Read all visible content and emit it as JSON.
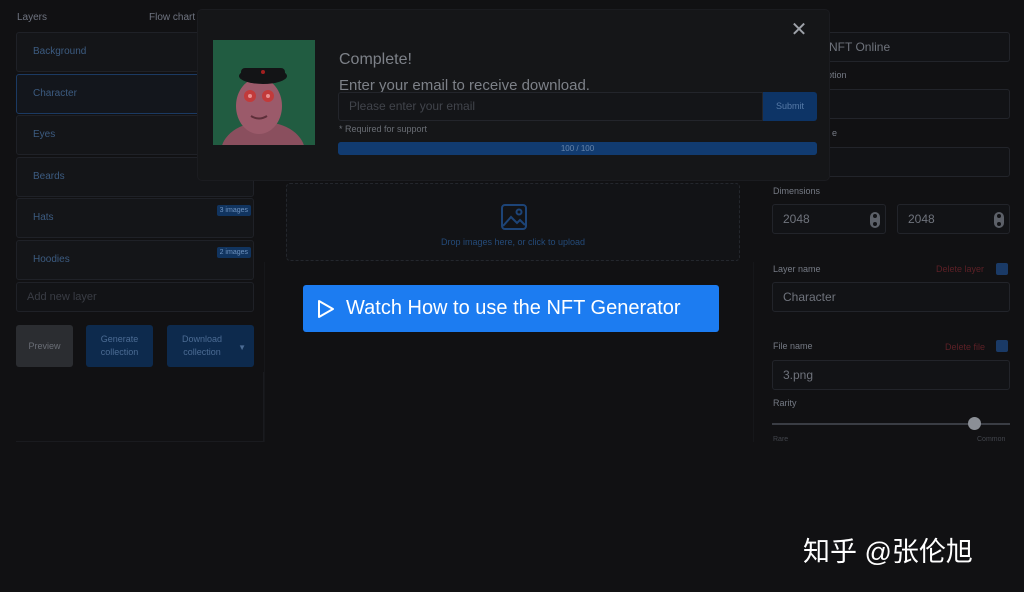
{
  "left": {
    "heading_layers": "Layers",
    "heading_flow": "Flow chart",
    "layers": [
      {
        "label": "Background",
        "badge": ""
      },
      {
        "label": "Character",
        "badge": ""
      },
      {
        "label": "Eyes",
        "badge": ""
      },
      {
        "label": "Beards",
        "badge": ""
      },
      {
        "label": "Hats",
        "badge": "3 images"
      },
      {
        "label": "Hoodies",
        "badge": "2 images"
      }
    ],
    "add_layer_placeholder": "Add new layer",
    "preview_label": "Preview",
    "generate_label": "Generate collection",
    "download_label": "Download collection"
  },
  "center": {
    "drop_text": "Drop images here, or click to upload"
  },
  "right": {
    "title_label_partial": "e",
    "title_value_partial": "e NFT Online",
    "description_label_partial": "ription",
    "size_label_partial": "e",
    "dimensions_label": "Dimensions",
    "width_value": "2048",
    "height_value": "2048",
    "layer_name_label": "Layer name",
    "delete_layer": "Delete layer",
    "layer_name_value": "Character",
    "file_name_label": "File name",
    "delete_file": "Delete file",
    "file_name_value": "3.png",
    "rarity_label": "Rarity",
    "rarity_min": "Rare",
    "rarity_max": "Common",
    "rarity_value": 0.85
  },
  "modal": {
    "title": "Complete!",
    "subtitle": "Enter your email to receive download.",
    "email_placeholder": "Please enter your email",
    "submit_label": "Submit",
    "required_note": "* Required for support",
    "progress_text": "100 / 100",
    "progress_fraction": 1.0,
    "close_glyph": "✕"
  },
  "watch_button": {
    "label": "Watch How to use the NFT Generator"
  },
  "watermark": {
    "text": "知乎 @张伦旭"
  },
  "colors": {
    "accent": "#1c7cf1",
    "background": "#111113"
  }
}
